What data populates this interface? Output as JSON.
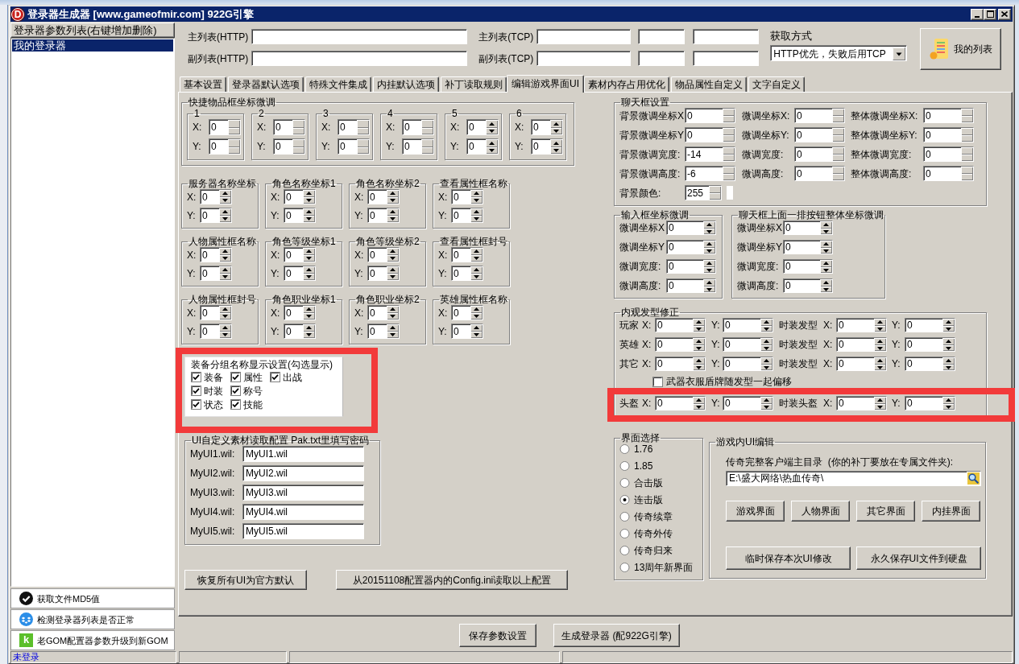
{
  "window": {
    "title": "登录器生成器 [www.gameofmir.com] 922G引擎",
    "icon_text": "D"
  },
  "sidebar": {
    "header": "登录器参数列表(右键增加删除)",
    "items": [
      {
        "label": "我的登录器",
        "selected": true
      }
    ],
    "actions": [
      {
        "kind": "check",
        "label": "获取文件MD5值"
      },
      {
        "kind": "diamond",
        "label": "检测登录器列表是否正常"
      },
      {
        "kind": "letter",
        "icon_text": "k",
        "label": "老GOM配置器参数升级到新GOM"
      }
    ]
  },
  "server_lists": [
    {
      "entries": [
        {
          "kind": "http",
          "label": "主列表(HTTP)"
        },
        {
          "kind": "tcp",
          "label": "主列表(TCP)"
        }
      ]
    },
    {
      "entries": [
        {
          "kind": "http",
          "label": "副列表(HTTP)"
        },
        {
          "kind": "tcp",
          "label": "副列表(TCP)"
        }
      ]
    }
  ],
  "fetch_mode": {
    "label": "获取方式",
    "value": "HTTP优先，失败后用TCP"
  },
  "my_list_button": {
    "label": "我的列表"
  },
  "tabs": [
    {
      "label": "基本设置",
      "selected": false
    },
    {
      "label": "登录器默认选项",
      "selected": false
    },
    {
      "label": "特殊文件集成",
      "selected": false
    },
    {
      "label": "内挂默认选项",
      "selected": false
    },
    {
      "label": "补丁读取规则",
      "selected": false
    },
    {
      "label": "编辑游戏界面UI",
      "selected": true
    },
    {
      "label": "素材内存占用优化",
      "selected": false
    },
    {
      "label": "物品属性自定义",
      "selected": false
    },
    {
      "label": "文字自定义",
      "selected": false
    }
  ],
  "quick_slots": {
    "title": "快捷物品框坐标微调",
    "slots": [
      {
        "title": "1",
        "arrows": false,
        "fields": [
          {
            "label": "X:",
            "value": "0"
          },
          {
            "label": "Y:",
            "value": "0"
          }
        ]
      },
      {
        "title": "2",
        "arrows": false,
        "fields": [
          {
            "label": "X:",
            "value": "0"
          },
          {
            "label": "Y:",
            "value": "0"
          }
        ]
      },
      {
        "title": "3",
        "arrows": false,
        "fields": [
          {
            "label": "X:",
            "value": "0"
          },
          {
            "label": "Y:",
            "value": "0"
          }
        ]
      },
      {
        "title": "4",
        "arrows": false,
        "fields": [
          {
            "label": "X:",
            "value": "0"
          },
          {
            "label": "Y:",
            "value": "0"
          }
        ]
      },
      {
        "title": "5",
        "arrows": true,
        "fields": [
          {
            "label": "X:",
            "value": "0"
          },
          {
            "label": "Y:",
            "value": "0"
          }
        ]
      },
      {
        "title": "6",
        "arrows": true,
        "fields": [
          {
            "label": "X:",
            "value": "0"
          },
          {
            "label": "Y:",
            "value": "0"
          }
        ]
      }
    ]
  },
  "coord_groups": [
    {
      "title": "服务器名称坐标",
      "arrows": true,
      "fields": [
        {
          "label": "X:",
          "value": "0"
        },
        {
          "label": "Y:",
          "value": "0"
        }
      ]
    },
    {
      "title": "角色名称坐标1",
      "arrows": true,
      "fields": [
        {
          "label": "X:",
          "value": "0"
        },
        {
          "label": "Y:",
          "value": "0"
        }
      ]
    },
    {
      "title": "角色名称坐标2",
      "arrows": true,
      "fields": [
        {
          "label": "X:",
          "value": "0"
        },
        {
          "label": "Y:",
          "value": "0"
        }
      ]
    },
    {
      "title": "查看属性框名称",
      "arrows": true,
      "fields": [
        {
          "label": "X:",
          "value": "0"
        },
        {
          "label": "Y:",
          "value": "0"
        }
      ]
    },
    {
      "title": "人物属性框名称",
      "arrows": true,
      "fields": [
        {
          "label": "X:",
          "value": "0"
        },
        {
          "label": "Y:",
          "value": "0"
        }
      ]
    },
    {
      "title": "角色等级坐标1",
      "arrows": true,
      "fields": [
        {
          "label": "X:",
          "value": "0"
        },
        {
          "label": "Y:",
          "value": "0"
        }
      ]
    },
    {
      "title": "角色等级坐标2",
      "arrows": true,
      "fields": [
        {
          "label": "X:",
          "value": "0"
        },
        {
          "label": "Y:",
          "value": "0"
        }
      ]
    },
    {
      "title": "查看属性框封号",
      "arrows": true,
      "fields": [
        {
          "label": "X:",
          "value": "0"
        },
        {
          "label": "Y:",
          "value": "0"
        }
      ]
    },
    {
      "title": "人物属性框封号",
      "arrows": true,
      "fields": [
        {
          "label": "X:",
          "value": "0"
        },
        {
          "label": "Y:",
          "value": "0"
        }
      ]
    },
    {
      "title": "角色职业坐标1",
      "arrows": true,
      "fields": [
        {
          "label": "X:",
          "value": "0"
        },
        {
          "label": "Y:",
          "value": "0"
        }
      ]
    },
    {
      "title": "角色职业坐标2",
      "arrows": true,
      "fields": [
        {
          "label": "X:",
          "value": "0"
        },
        {
          "label": "Y:",
          "value": "0"
        }
      ]
    },
    {
      "title": "英雄属性框名称",
      "arrows": true,
      "fields": [
        {
          "label": "X:",
          "value": "0"
        },
        {
          "label": "Y:",
          "value": "0"
        }
      ]
    }
  ],
  "equip_display": {
    "title": "装备分组名称显示设置(勾选显示)",
    "highlighted": true,
    "rows": [
      {
        "items": [
          {
            "label": "装备",
            "checked": true
          },
          {
            "label": "属性",
            "checked": true
          },
          {
            "label": "出战",
            "checked": true
          }
        ]
      },
      {
        "items": [
          {
            "label": "时装",
            "checked": true
          },
          {
            "label": "称号",
            "checked": true
          }
        ]
      },
      {
        "items": [
          {
            "label": "状态",
            "checked": true
          },
          {
            "label": "技能",
            "checked": true
          }
        ]
      }
    ]
  },
  "ui_assets": {
    "title": "UI自定义素材读取配置 Pak.txt里填写密码",
    "rows": [
      {
        "label": "MyUI1.wil:",
        "value": "MyUI1.wil"
      },
      {
        "label": "MyUI2.wil:",
        "value": "MyUI2.wil"
      },
      {
        "label": "MyUI3.wil:",
        "value": "MyUI3.wil"
      },
      {
        "label": "MyUI4.wil:",
        "value": "MyUI4.wil"
      },
      {
        "label": "MyUI5.wil:",
        "value": "MyUI5.wil"
      }
    ]
  },
  "left_buttons": [
    "恢复所有UI为官方默认",
    "从20151108配置器内的Config.ini读取以上配置"
  ],
  "chat_box": {
    "title": "聊天框设置",
    "arrows": false,
    "rows": [
      {
        "fields": [
          {
            "label": "背景微调坐标X",
            "value": "0"
          },
          {
            "label": "微调坐标X:",
            "value": "0"
          },
          {
            "label": "整体微调坐标X:",
            "value": "0"
          }
        ]
      },
      {
        "fields": [
          {
            "label": "背景微调坐标Y",
            "value": "0"
          },
          {
            "label": "微调坐标Y:",
            "value": "0"
          },
          {
            "label": "整体微调坐标Y:",
            "value": "0"
          }
        ]
      },
      {
        "fields": [
          {
            "label": "背景微调宽度:",
            "value": "-14"
          },
          {
            "label": "微调宽度:",
            "value": "0"
          },
          {
            "label": "整体微调宽度:",
            "value": "0"
          }
        ]
      },
      {
        "fields": [
          {
            "label": "背景微调高度:",
            "value": "-6"
          },
          {
            "label": "微调高度:",
            "value": "0"
          },
          {
            "label": "整体微调高度:",
            "value": "0"
          }
        ]
      }
    ],
    "color_row": {
      "label": "背景颜色:",
      "value": "255"
    }
  },
  "input_groups": [
    {
      "title": "输入框坐标微调",
      "arrows": true,
      "fields": [
        {
          "label": "微调坐标X",
          "value": "0"
        },
        {
          "label": "微调坐标Y",
          "value": "0"
        },
        {
          "label": "微调宽度:",
          "value": "0"
        },
        {
          "label": "微调高度:",
          "value": "0"
        }
      ]
    },
    {
      "title": "聊天框上面一排按钮整体坐标微调",
      "arrows": true,
      "fields": [
        {
          "label": "微调坐标X",
          "value": "0"
        },
        {
          "label": "微调坐标Y",
          "value": "0"
        },
        {
          "label": "微调宽度:",
          "value": "0"
        },
        {
          "label": "微调高度:",
          "value": "0"
        }
      ]
    }
  ],
  "hair_fix": {
    "title": "内观发型修正",
    "arrows": true,
    "rows": [
      {
        "kind": "coords",
        "name": "玩家",
        "fields": [
          {
            "label": "X:",
            "value": "0"
          },
          {
            "label": "Y:",
            "value": "0"
          }
        ],
        "fashion_name": "时装发型",
        "fashion_fields": [
          {
            "label": "X:",
            "value": "0"
          },
          {
            "label": "Y:",
            "value": "0"
          }
        ],
        "highlighted": false
      },
      {
        "kind": "coords",
        "name": "英雄",
        "fields": [
          {
            "label": "X:",
            "value": "0"
          },
          {
            "label": "Y:",
            "value": "0"
          }
        ],
        "fashion_name": "时装发型",
        "fashion_fields": [
          {
            "label": "X:",
            "value": "0"
          },
          {
            "label": "Y:",
            "value": "0"
          }
        ],
        "highlighted": false
      },
      {
        "kind": "coords",
        "name": "其它",
        "fields": [
          {
            "label": "X:",
            "value": "0"
          },
          {
            "label": "Y:",
            "value": "0"
          }
        ],
        "fashion_name": "时装发型",
        "fashion_fields": [
          {
            "label": "X:",
            "value": "0"
          },
          {
            "label": "Y:",
            "value": "0"
          }
        ],
        "highlighted": false
      },
      {
        "kind": "checkbox",
        "label": "武器衣服盾牌随发型一起偏移",
        "checked": false
      },
      {
        "kind": "coords",
        "name": "头盔",
        "fields": [
          {
            "label": "X:",
            "value": "0"
          },
          {
            "label": "Y:",
            "value": "0"
          }
        ],
        "fashion_name": "时装头盔",
        "fashion_fields": [
          {
            "label": "X:",
            "value": "0"
          },
          {
            "label": "Y:",
            "value": "0"
          }
        ],
        "highlighted": true
      }
    ]
  },
  "ui_select": {
    "title": "界面选择",
    "options": [
      {
        "label": "1.76",
        "selected": false
      },
      {
        "label": "1.85",
        "selected": false
      },
      {
        "label": "合击版",
        "selected": false
      },
      {
        "label": "连击版",
        "selected": true
      },
      {
        "label": "传奇续章",
        "selected": false
      },
      {
        "label": "传奇外传",
        "selected": false
      },
      {
        "label": "传奇归来",
        "selected": false
      },
      {
        "label": "13周年新界面",
        "selected": false
      }
    ]
  },
  "ui_edit": {
    "title": "游戏内UI编辑",
    "dir_label": "传奇完整客户端主目录  (你的补丁要放在专属文件夹):",
    "dir_value": "E:\\盛大网络\\热血传奇\\",
    "buttons": [
      "游戏界面",
      "人物界面",
      "其它界面",
      "内挂界面"
    ],
    "save_buttons": [
      "临时保存本次UI修改",
      "永久保存UI文件到硬盘"
    ]
  },
  "footer_buttons": [
    "保存参数设置",
    "生成登录器 (配922G引擎)"
  ],
  "status_bar": {
    "text": "未登录"
  }
}
